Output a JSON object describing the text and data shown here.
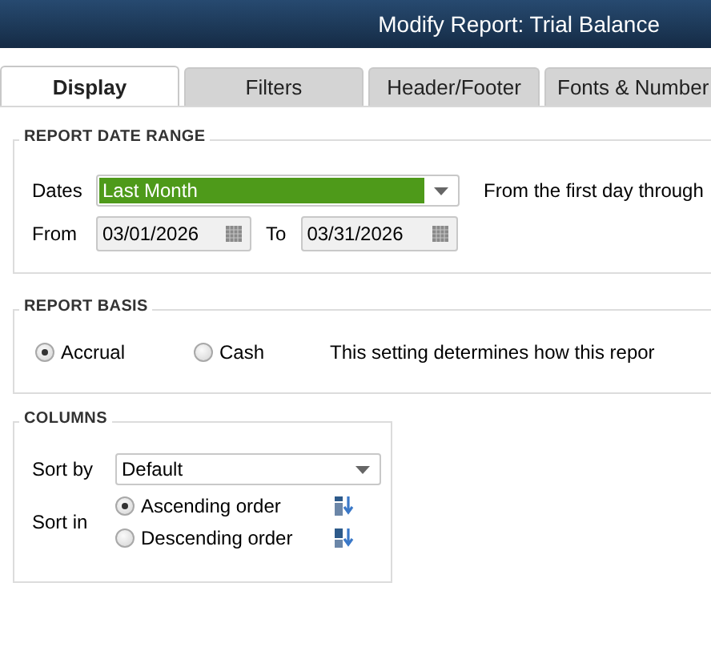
{
  "window": {
    "title": "Modify Report: Trial Balance"
  },
  "tabs": [
    {
      "label": "Display",
      "selected": true
    },
    {
      "label": "Filters",
      "selected": false
    },
    {
      "label": "Header/Footer",
      "selected": false
    },
    {
      "label": "Fonts & Number",
      "selected": false
    }
  ],
  "report_date_range": {
    "title": "REPORT DATE RANGE",
    "dates": {
      "label": "Dates",
      "value": "Last Month",
      "highlighted": true
    },
    "description": "From the first day through",
    "from": {
      "label": "From",
      "value": "03/01/2026"
    },
    "to": {
      "label": "To",
      "value": "03/31/2026"
    }
  },
  "report_basis": {
    "title": "REPORT BASIS",
    "options": [
      {
        "label": "Accrual",
        "selected": true
      },
      {
        "label": "Cash",
        "selected": false
      }
    ],
    "description": "This setting determines how this repor"
  },
  "columns": {
    "title": "COLUMNS",
    "sort_by": {
      "label": "Sort by",
      "value": "Default"
    },
    "sort_in": {
      "label": "Sort in",
      "options": [
        {
          "label": "Ascending order",
          "selected": true,
          "kind": "ascending"
        },
        {
          "label": "Descending order",
          "selected": false,
          "kind": "descending"
        }
      ]
    }
  }
}
